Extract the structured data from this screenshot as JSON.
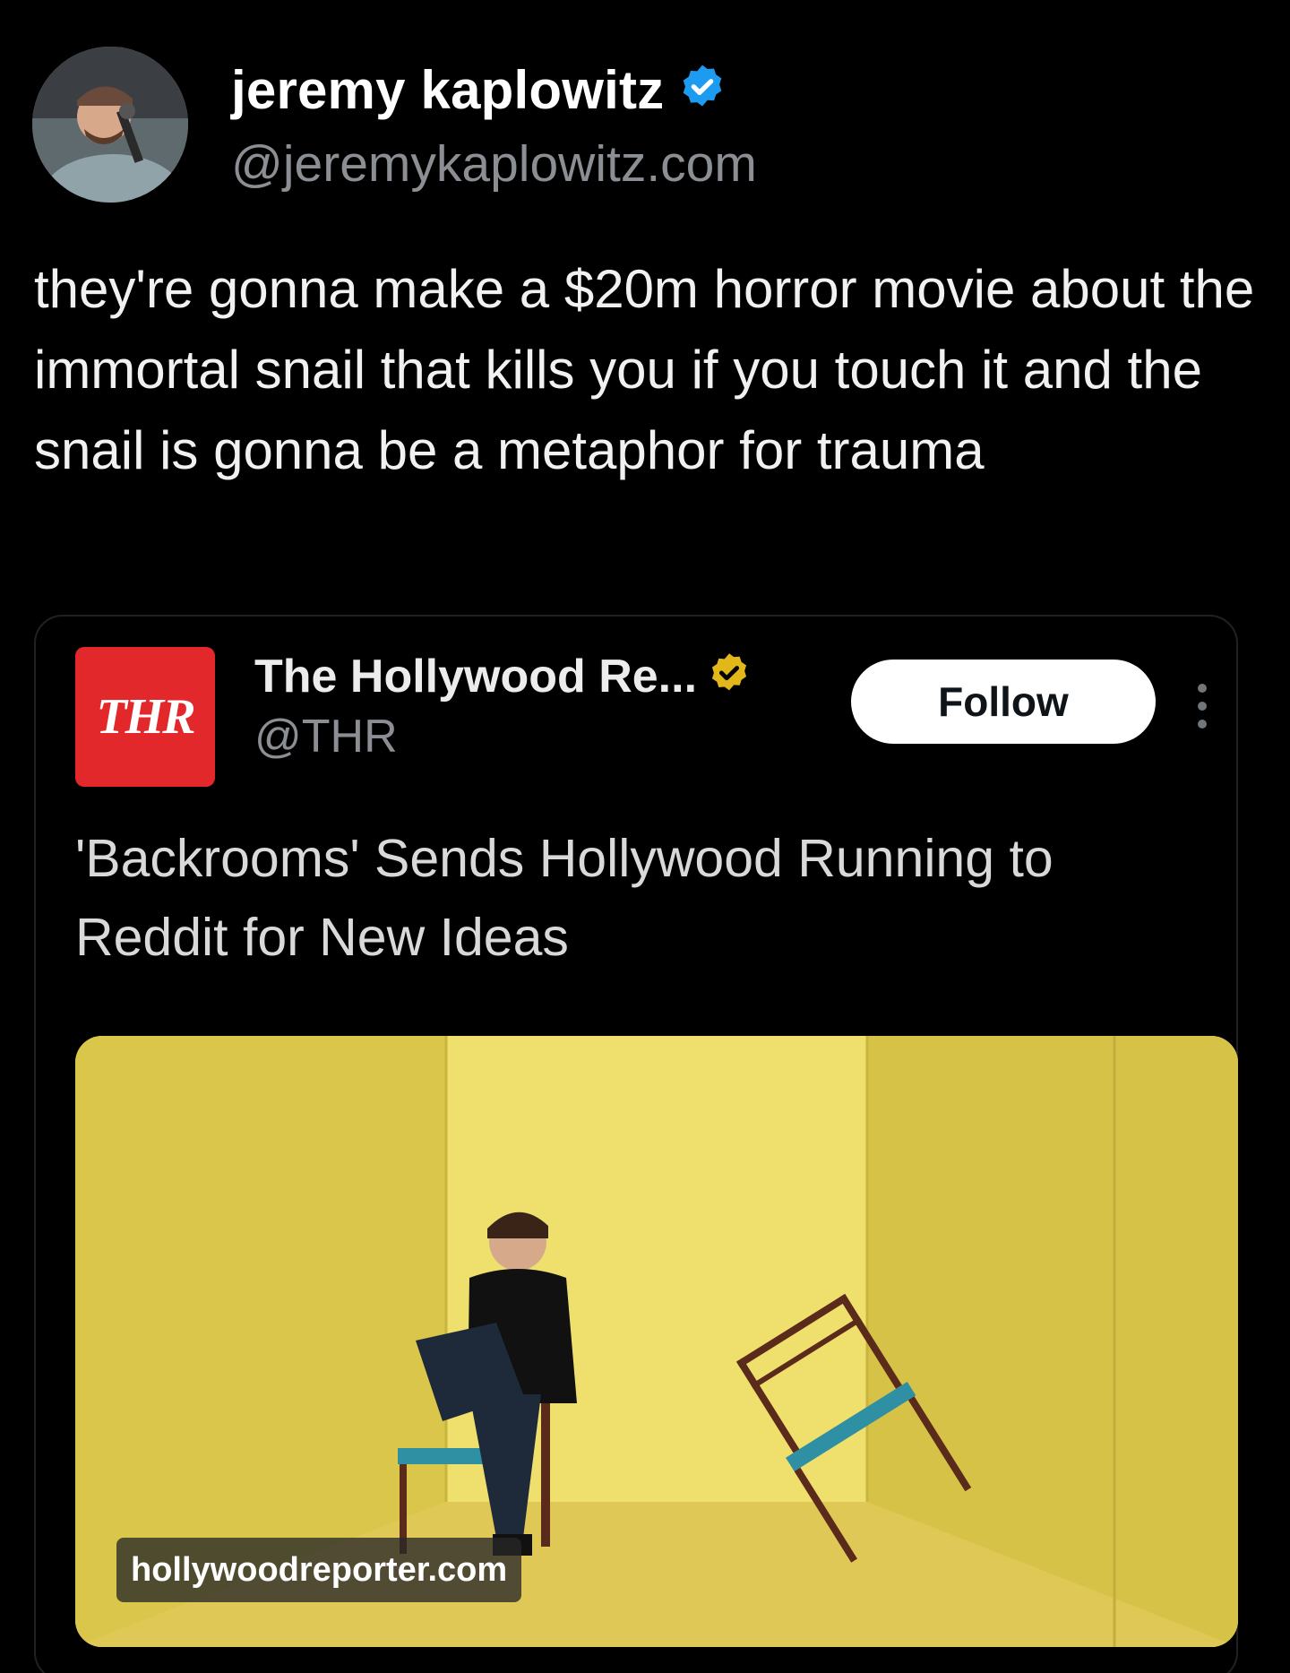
{
  "post": {
    "author_name": "jeremy kaplowitz",
    "author_handle": "@jeremykaplowitz.com",
    "verified_icon": "blue-verified-badge-icon",
    "text": "they're gonna make a $20m horror movie about the immortal snail that kills you if you touch it and the snail is gonna be a metaphor for trauma"
  },
  "embed": {
    "logo_text": "THR",
    "account_name": "The Hollywood Re...",
    "account_handle": "@THR",
    "verified_icon": "gold-verified-badge-icon",
    "follow_label": "Follow",
    "more_icon": "more-options-icon",
    "headline": "'Backrooms' Sends Hollywood Running to Reddit for New Ideas",
    "image_source": "hollywoodreporter.com"
  },
  "colors": {
    "background": "#000000",
    "verified_blue": "#1d9bf0",
    "gold_badge": "#e2b719",
    "thr_red": "#e3282b"
  }
}
